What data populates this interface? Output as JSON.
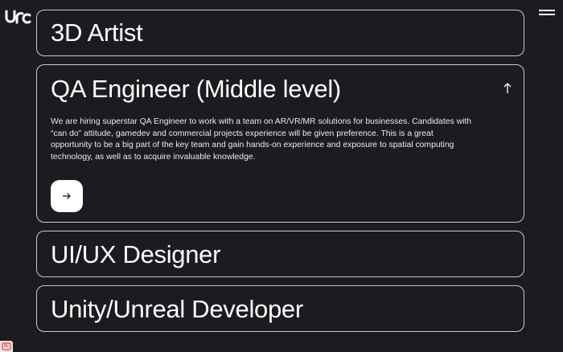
{
  "header": {
    "logo_icon": "urc-logo-icon",
    "menu_icon": "hamburger-menu-icon"
  },
  "vacancies": [
    {
      "title": "3D Artist",
      "expanded": false
    },
    {
      "title": "QA Engineer (Middle level)",
      "expanded": true,
      "toggle_icon": "arrow-up-icon",
      "description": "We are hiring superstar QA Engineer to work with a team on AR/VR/MR solutions for businesses. Candidates with “can do” attitude, gamedev and commercial projects experience will be given preference. This is a great opportunity to be a big part of the key team and gain hands-on experience and exposure to spatial computing technology, as well as to acquire invaluable knowledge.",
      "apply_icon": "arrow-right-icon"
    },
    {
      "title": "UI/UX Designer",
      "expanded": false
    },
    {
      "title": "Unity/Unreal Developer",
      "expanded": false
    }
  ],
  "colors": {
    "background": "#1c1b20",
    "card_border": "#c9c8cf",
    "text": "#ffffff",
    "button_bg": "#ffffff",
    "badge_accent": "#e0483a"
  }
}
